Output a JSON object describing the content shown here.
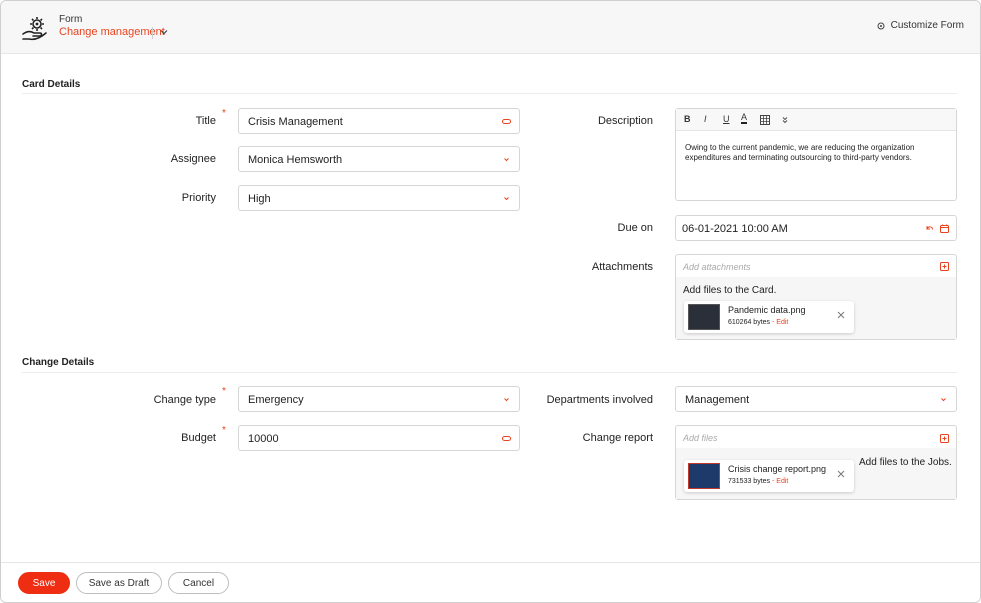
{
  "header": {
    "form_label": "Form",
    "form_name": "Change management",
    "customize_label": "Customize Form"
  },
  "card_details": {
    "section_title": "Card Details",
    "title": {
      "label": "Title",
      "required": "*",
      "value": "Crisis Management"
    },
    "assignee": {
      "label": "Assignee",
      "value": "Monica Hemsworth"
    },
    "priority": {
      "label": "Priority",
      "value": "High"
    },
    "description": {
      "label": "Description",
      "toolbar": [
        "B",
        "I",
        "U",
        "A"
      ],
      "text": "Owing to the current pandemic, we are reducing the organization expenditures and terminating outsourcing to third-party vendors."
    },
    "due_on": {
      "label": "Due on",
      "value": "06-01-2021 10:00 AM"
    },
    "attachments": {
      "label": "Attachments",
      "placeholder": "Add attachments",
      "drop_text": "Add files to the Card.",
      "file": {
        "name": "Pandemic data.png",
        "size": "610264 bytes",
        "edit": "- Edit"
      }
    }
  },
  "change_details": {
    "section_title": "Change Details",
    "change_type": {
      "label": "Change type",
      "required": "*",
      "value": "Emergency"
    },
    "budget": {
      "label": "Budget",
      "required": "*",
      "value": "10000"
    },
    "departments": {
      "label": "Departments involved",
      "value": "Management"
    },
    "change_report": {
      "label": "Change report",
      "placeholder": "Add files",
      "drop_text": "Add files to the Jobs.",
      "file": {
        "name": "Crisis change report.png",
        "size": "731533 bytes",
        "edit": "- Edit"
      }
    }
  },
  "footer": {
    "save": "Save",
    "save_draft": "Save as Draft",
    "cancel": "Cancel"
  },
  "colors": {
    "accent": "#ee2d12",
    "brand_text": "#e8431f"
  }
}
